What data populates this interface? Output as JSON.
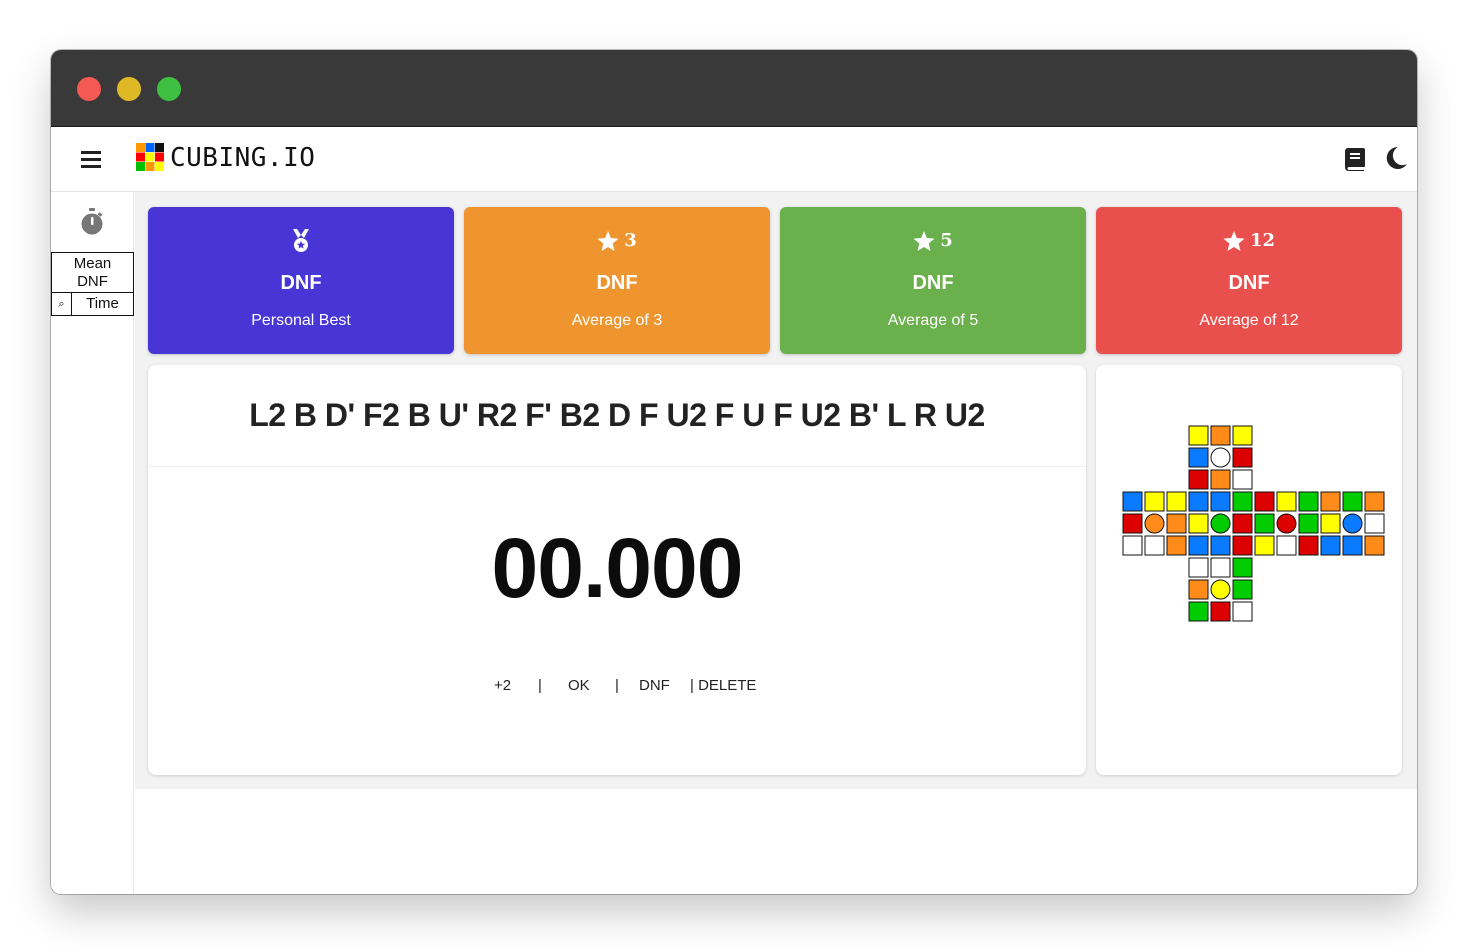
{
  "app": {
    "logo_text": "CUBING.IO"
  },
  "header": {
    "menu_icon": "hamburger-menu-icon",
    "book_icon": "book-icon",
    "theme_icon": "moon-icon"
  },
  "sidebar": {
    "icon": "stopwatch-icon",
    "stats_header": [
      "Mean",
      "DNF"
    ],
    "search_icon": "search-icon",
    "column_label": "Time"
  },
  "stats": [
    {
      "icon": "medal-icon",
      "badge": "",
      "value": "DNF",
      "label": "Personal Best",
      "color": "#4735d6"
    },
    {
      "icon": "star-icon",
      "badge": "3",
      "value": "DNF",
      "label": "Average of 3",
      "color": "#ef9530"
    },
    {
      "icon": "star-icon",
      "badge": "5",
      "value": "DNF",
      "label": "Average of 5",
      "color": "#6ab04c"
    },
    {
      "icon": "star-icon",
      "badge": "12",
      "value": "DNF",
      "label": "Average of 12",
      "color": "#e94f4d"
    }
  ],
  "scramble": "L2 B D' F2 B U' R2 F' B2 D F U2 F U F U2 B' L R U2",
  "timer": "00.000",
  "actions": {
    "plus2": "+2",
    "sep1": "|",
    "ok": "OK",
    "sep2": "|",
    "dnf": "DNF",
    "delete": "| DELETE"
  },
  "cube_colors": {
    "Y": "#ffff00",
    "O": "#ff8c1a",
    "W": "#ffffff",
    "B": "#0a7aff",
    "R": "#dd0000",
    "G": "#00cc00"
  },
  "cube_net": {
    "U": [
      "YOY",
      "BWR",
      "RO W"
    ],
    "L": [
      "BYY",
      "ROO",
      "WWO"
    ],
    "F": [
      "BBG",
      "YGR",
      "BBR"
    ],
    "R": [
      "RYG",
      "GRG",
      "YWR"
    ],
    "B": [
      "OGO",
      "YBW",
      "BBO"
    ],
    "D": [
      "WWG",
      "OYG",
      "GRW"
    ]
  }
}
